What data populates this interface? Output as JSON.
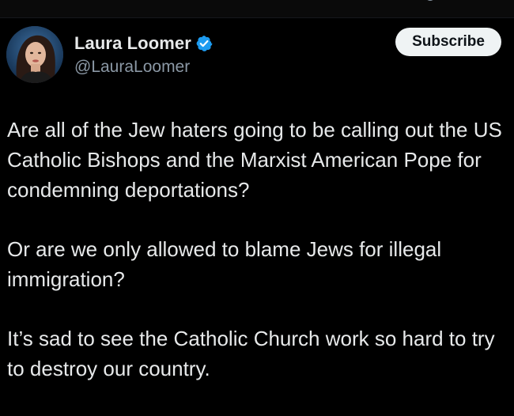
{
  "author": {
    "display_name": "Laura Loomer",
    "handle": "@LauraLoomer",
    "verified": true,
    "verified_color": "#1d9bf0",
    "avatar_icon": "profile-photo"
  },
  "actions": {
    "subscribe_label": "Subscribe"
  },
  "tweet": {
    "paragraphs": [
      "Are all of the Jew haters going to be calling out the US Catholic Bishops and the Marxist American Pope for condemning deportations?",
      "Or are we only allowed to blame Jews for illegal immigration?",
      "It’s sad to see the Catholic Church work so hard to try to destroy our country."
    ]
  },
  "colors": {
    "background": "#000000",
    "text_primary": "#e7e9ea",
    "text_secondary": "#8b98a5",
    "button_bg": "#eff3f4",
    "button_text": "#0f1419"
  }
}
